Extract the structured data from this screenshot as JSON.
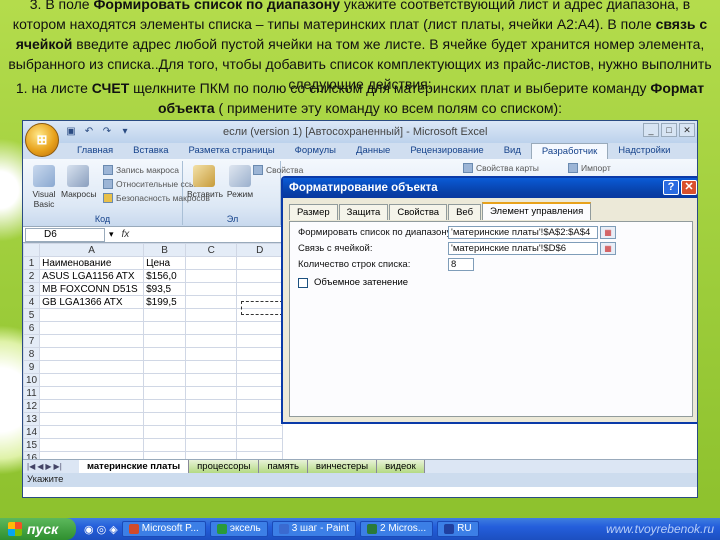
{
  "slide": {
    "p1_pre": "3. В поле ",
    "p1_bold1": "Формировать список по диапазону",
    "p1_mid1": " укажите соответствующий лист и адрес диапазона, в котором находятся элементы списка – типы материнских  плат (лист платы, ячейки А2:А4). В поле ",
    "p1_bold2": "связь с ячейкой",
    "p1_mid2": " введите  адрес любой пустой ячейки на том же листе. В ячейке будет хранится номер элемента, выбранного из списка..Для того, чтобы добавить список комплектующих из прайс-листов, нужно выполнить",
    "p1_end": "следующие действия:",
    "p2_pre": "1. на листе ",
    "p2_bold1": "СЧЕТ",
    "p2_mid1": " щелкните ПКМ по полю со списком для материнских плат и выберите команду ",
    "p2_bold2": "Формат объекта",
    "p2_end": " ( примените эту команду ко всем полям со списком):"
  },
  "excel": {
    "title": "если (version 1) [Автосохраненный] - Microsoft Excel",
    "tabs": [
      "Главная",
      "Вставка",
      "Разметка страницы",
      "Формулы",
      "Данные",
      "Рецензирование",
      "Вид",
      "Разработчик",
      "Надстройки"
    ],
    "active_tab": "Разработчик",
    "ribbon": {
      "vb": "Visual Basic",
      "macros": "Макросы",
      "record_macro": "Запись макроса",
      "relative_refs": "Относительные ссылки",
      "macro_security": "Безопасность макросов",
      "group_code": "Код",
      "insert": "Вставить",
      "design": "Режим",
      "properties": "Свойства",
      "group_controls": "Эл",
      "map_properties": "Свойства карты",
      "import": "Импорт"
    },
    "namebox": "D6",
    "columns": [
      "A",
      "B",
      "C",
      "D"
    ],
    "rows": [
      {
        "n": "1",
        "a": "Наименование",
        "b": "Цена"
      },
      {
        "n": "2",
        "a": "ASUS LGA1156 ATX",
        "b": "$156,0"
      },
      {
        "n": "3",
        "a": "MB FOXCONN D51S",
        "b": "$93,5"
      },
      {
        "n": "4",
        "a": "GB LGA1366 ATX",
        "b": "$199,5"
      },
      {
        "n": "5",
        "a": "",
        "b": ""
      },
      {
        "n": "6",
        "a": "",
        "b": ""
      },
      {
        "n": "7",
        "a": "",
        "b": ""
      },
      {
        "n": "8",
        "a": "",
        "b": ""
      },
      {
        "n": "9",
        "a": "",
        "b": ""
      },
      {
        "n": "10",
        "a": "",
        "b": ""
      },
      {
        "n": "11",
        "a": "",
        "b": ""
      },
      {
        "n": "12",
        "a": "",
        "b": ""
      },
      {
        "n": "13",
        "a": "",
        "b": ""
      },
      {
        "n": "14",
        "a": "",
        "b": ""
      },
      {
        "n": "15",
        "a": "",
        "b": ""
      },
      {
        "n": "16",
        "a": "",
        "b": ""
      },
      {
        "n": "17",
        "a": "",
        "b": ""
      }
    ],
    "sheets": [
      "материнские платы",
      "процессоры",
      "память",
      "винчестеры",
      "видеок"
    ],
    "status": "Укажите"
  },
  "dialog": {
    "title": "Форматирование объекта",
    "tabs": [
      "Размер",
      "Защита",
      "Свойства",
      "Веб",
      "Элемент управления"
    ],
    "active_tab": "Элемент управления",
    "range_label": "Формировать список по диапазону:",
    "range_value": "'материнские платы'!$A$2:$A$4",
    "link_label": "Связь с ячейкой:",
    "link_value": "'материнские платы'!$D$6",
    "count_label": "Количество строк списка:",
    "count_value": "8",
    "shading_label": "Объемное затенение"
  },
  "taskbar": {
    "start": "пуск",
    "items": [
      "Microsoft P...",
      "эксель",
      "3 шаг - Paint",
      "2 Micros...",
      "RU"
    ],
    "watermark": "www.tvoyrebenok.ru"
  }
}
